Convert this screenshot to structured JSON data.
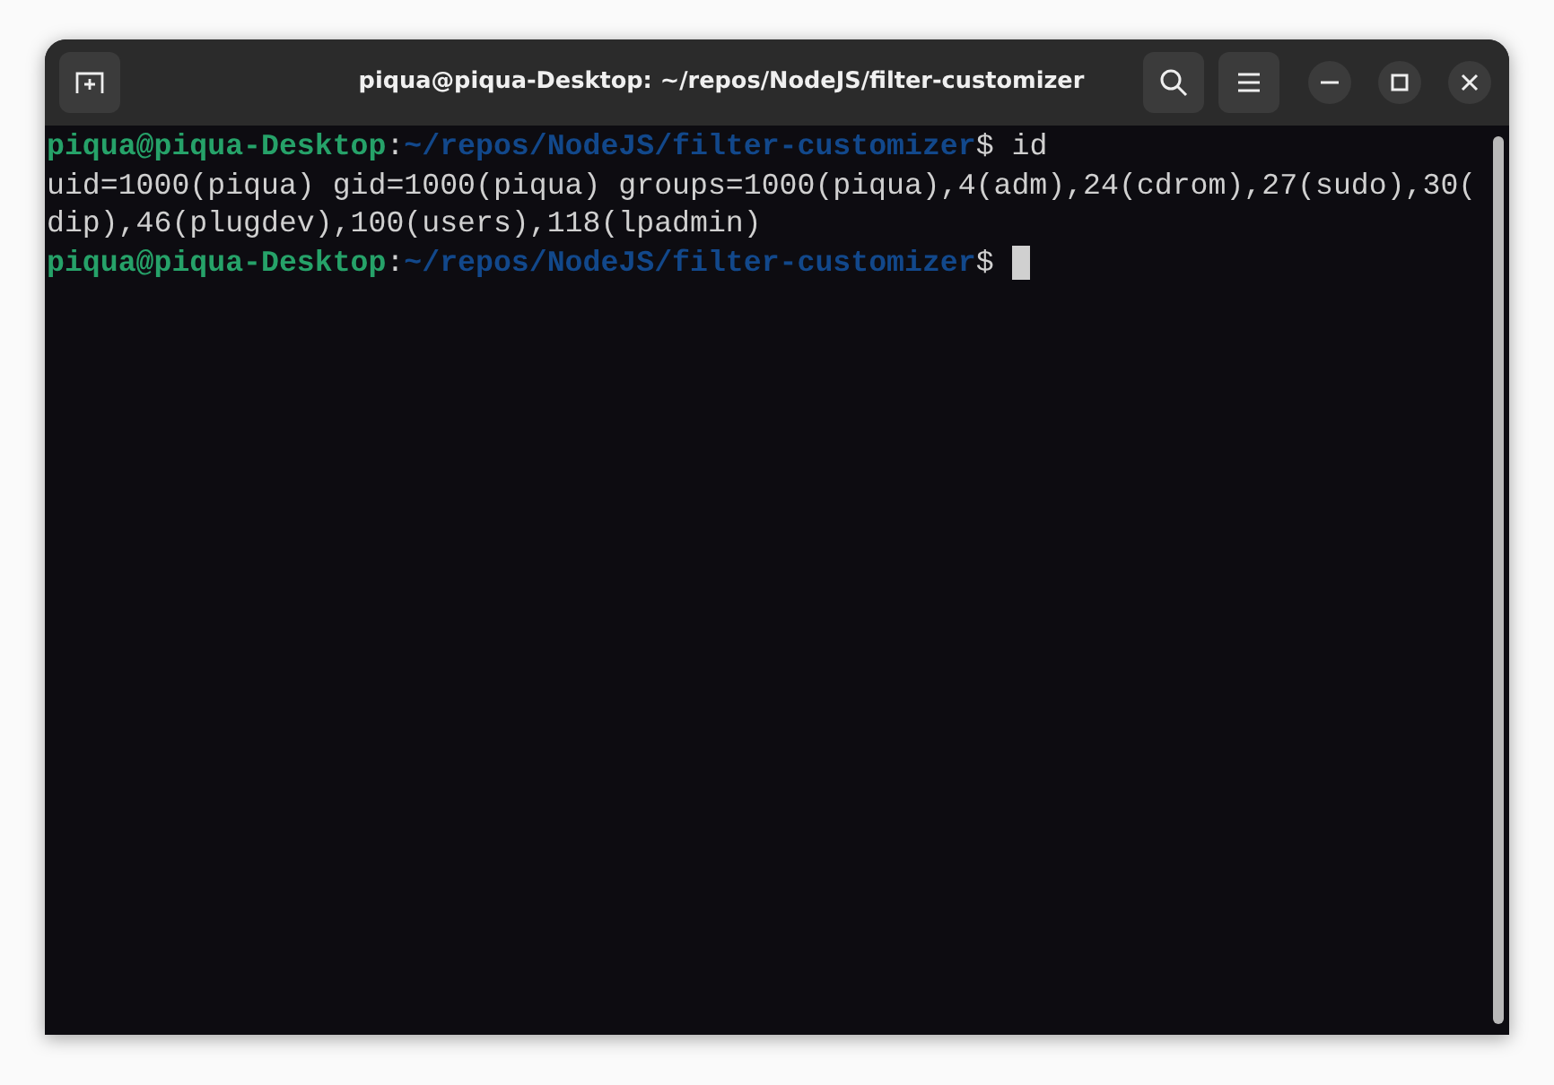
{
  "window": {
    "title": "piqua@piqua-Desktop: ~/repos/NodeJS/filter-customizer"
  },
  "terminal": {
    "lines": [
      {
        "kind": "prompt",
        "user_host": "piqua@piqua-Desktop",
        "separator": ":",
        "path": "~/repos/NodeJS/filter-customizer",
        "symbol": "$",
        "command": "id",
        "cursor": false
      },
      {
        "kind": "output",
        "text": "uid=1000(piqua) gid=1000(piqua) groups=1000(piqua),4(adm),24(cdrom),27(sudo),30("
      },
      {
        "kind": "output",
        "text": "dip),46(plugdev),100(users),118(lpadmin)"
      },
      {
        "kind": "prompt",
        "user_host": "piqua@piqua-Desktop",
        "separator": ":",
        "path": "~/repos/NodeJS/filter-customizer",
        "symbol": "$",
        "cursor": true
      }
    ]
  }
}
